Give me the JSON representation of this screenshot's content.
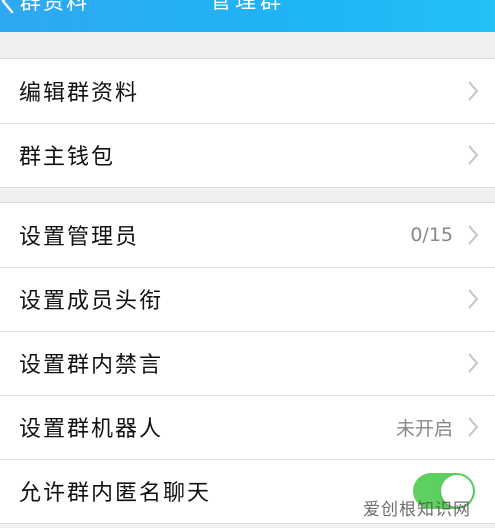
{
  "navbar": {
    "back_label": "群资料",
    "title": "管理群",
    "color": "#26aff3"
  },
  "groups": [
    {
      "items": [
        {
          "label": "编辑群资料",
          "value": ""
        },
        {
          "label": "群主钱包",
          "value": ""
        }
      ]
    },
    {
      "items": [
        {
          "label": "设置管理员",
          "value": "0/15"
        },
        {
          "label": "设置成员头衔",
          "value": ""
        },
        {
          "label": "设置群内禁言",
          "value": ""
        },
        {
          "label": "设置群机器人",
          "value": "未开启"
        },
        {
          "label": "允许群内匿名聊天",
          "toggle": true,
          "toggle_color": "#5ed05f"
        }
      ]
    }
  ],
  "watermark": "爱创根知识网"
}
